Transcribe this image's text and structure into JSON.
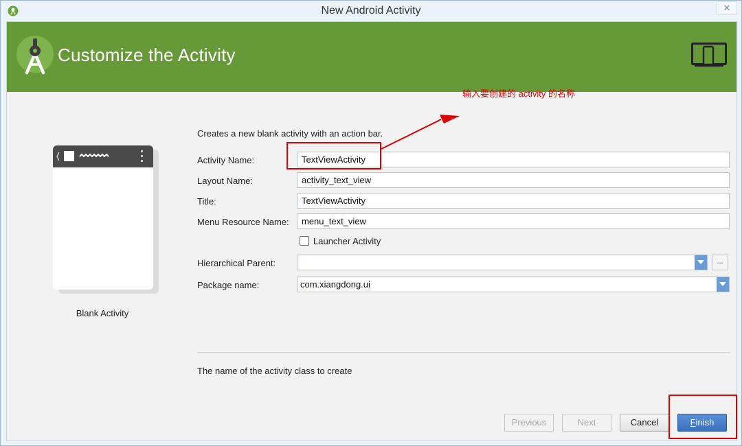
{
  "window": {
    "title": "New Android Activity",
    "close_glyph": "✕"
  },
  "banner": {
    "title": "Customize the Activity",
    "background": "#669a38"
  },
  "preview": {
    "label": "Blank Activity"
  },
  "form": {
    "description": "Creates a new blank activity with an action bar.",
    "activity_name": {
      "label": "Activity Name:",
      "value": "TextViewActivity"
    },
    "layout_name": {
      "label": "Layout Name:",
      "value": "activity_text_view"
    },
    "title": {
      "label": "Title:",
      "value": "TextViewActivity"
    },
    "menu_resource_name": {
      "label": "Menu Resource Name:",
      "value": "menu_text_view"
    },
    "launcher_activity": {
      "label": "Launcher Activity",
      "checked": false
    },
    "hierarchical_parent": {
      "label": "Hierarchical Parent:",
      "value": "",
      "browse_label": "..."
    },
    "package_name": {
      "label": "Package name:",
      "value": "com.xiangdong.ui"
    }
  },
  "help_text": "The name of the activity class to create",
  "buttons": {
    "previous": "Previous",
    "next": "Next",
    "cancel": "Cancel",
    "finish_first": "F",
    "finish_rest": "inish"
  },
  "annotation": {
    "note": "输入要创建的 activity 的名称",
    "color": "#e00000"
  }
}
